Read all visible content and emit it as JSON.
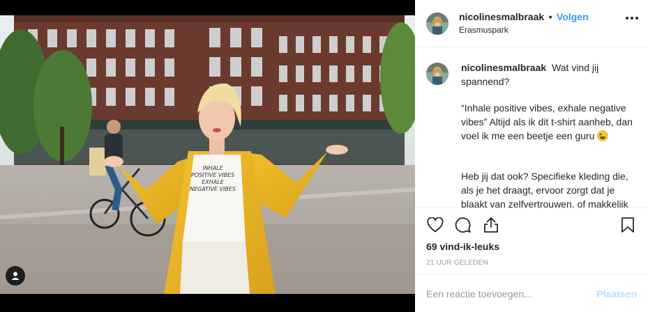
{
  "post": {
    "username": "nicolinesmalbraak",
    "separator": "•",
    "follow_label": "Volgen",
    "location": "Erasmuspark",
    "shirt_lines": [
      "INHALE",
      "POSITIVE VIBES",
      "EXHALE",
      "NEGATIVE VIBES"
    ]
  },
  "caption": {
    "username": "nicolinesmalbraak",
    "line1": "Wat vind jij spannend?",
    "para2": "“Inhale positive vibes, exhale negative vibes” Altijd als ik dit t-shirt aanheb, dan voel ik me een beetje een guru",
    "para3": "Heb jij dat ook? Specifieke kleding die, als je het draagt, ervoor zorgt dat je blaakt van zelfvertrouwen, of makkelijk"
  },
  "stats": {
    "likes": "69 vind-ik-leuks",
    "time": "21 UUR GELEDEN"
  },
  "comment": {
    "placeholder": "Een reactie toevoegen...",
    "post_label": "Plaatsen"
  },
  "icons": {
    "like": "heart-icon",
    "comment": "comment-icon",
    "share": "share-icon",
    "save": "bookmark-icon",
    "more": "more-icon",
    "tag": "user-tag-icon",
    "emoji": "laughing-emoji-icon"
  },
  "colors": {
    "accent": "#3897f0",
    "post_disabled": "#b2dffc",
    "muted": "#999999",
    "text": "#262626"
  }
}
